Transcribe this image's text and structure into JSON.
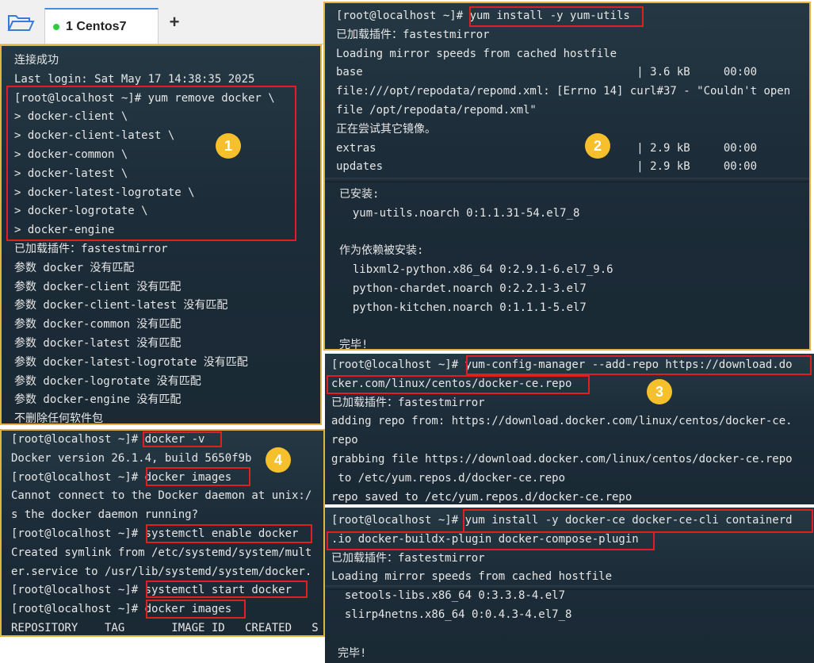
{
  "tabs": {
    "active_label": "1 Centos7",
    "add_label": "+"
  },
  "panel1": {
    "lines": [
      "连接成功",
      "Last login: Sat May 17 14:38:35 2025",
      "[root@localhost ~]# yum remove docker \\",
      "> docker-client \\",
      "> docker-client-latest \\",
      "> docker-common \\",
      "> docker-latest \\",
      "> docker-latest-logrotate \\",
      "> docker-logrotate \\",
      "> docker-engine",
      "已加载插件：fastestmirror",
      "参数 docker 没有匹配",
      "参数 docker-client 没有匹配",
      "参数 docker-client-latest 没有匹配",
      "参数 docker-common 没有匹配",
      "参数 docker-latest 没有匹配",
      "参数 docker-latest-logrotate 没有匹配",
      "参数 docker-logrotate 没有匹配",
      "参数 docker-engine 没有匹配",
      "不删除任何软件包"
    ],
    "badge": "1"
  },
  "panel2": {
    "lines": [
      "[root@localhost ~]# yum install -y yum-utils",
      "已加载插件：fastestmirror",
      "Loading mirror speeds from cached hostfile",
      "base                                         | 3.6 kB     00:00",
      "file:///opt/repodata/repomd.xml: [Errno 14] curl#37 - \"Couldn't open",
      "file /opt/repodata/repomd.xml\"",
      "正在尝试其它镜像。",
      "extras                                       | 2.9 kB     00:00",
      "updates                                      | 2.9 kB     00:00"
    ],
    "lines_b": [
      "已安装:",
      "  yum-utils.noarch 0:1.1.31-54.el7_8",
      "",
      "作为依赖被安装:",
      "  libxml2-python.x86_64 0:2.9.1-6.el7_9.6",
      "  python-chardet.noarch 0:2.2.1-3.el7",
      "  python-kitchen.noarch 0:1.1.1-5.el7",
      "",
      "完毕!"
    ],
    "badge": "2"
  },
  "panel3": {
    "lines": [
      "[root@localhost ~]# yum-config-manager --add-repo https://download.do",
      "cker.com/linux/centos/docker-ce.repo",
      "已加载插件：fastestmirror",
      "adding repo from: https://download.docker.com/linux/centos/docker-ce.",
      "repo",
      "grabbing file https://download.docker.com/linux/centos/docker-ce.repo",
      " to /etc/yum.repos.d/docker-ce.repo",
      "repo saved to /etc/yum.repos.d/docker-ce.repo"
    ],
    "badge": "3"
  },
  "panel4": {
    "lines": [
      "[root@localhost ~]# docker -v",
      "Docker version 26.1.4, build 5650f9b",
      "[root@localhost ~]# docker images",
      "Cannot connect to the Docker daemon at unix:/",
      "s the docker daemon running?",
      "[root@localhost ~]# systemctl enable docker",
      "Created symlink from /etc/systemd/system/mult",
      "er.service to /usr/lib/systemd/system/docker.",
      "[root@localhost ~]# systemctl start docker",
      "[root@localhost ~]# docker images",
      "REPOSITORY    TAG       IMAGE ID   CREATED   S"
    ],
    "badge": "4"
  },
  "panel5": {
    "lines": [
      "[root@localhost ~]# yum install -y docker-ce docker-ce-cli containerd",
      ".io docker-buildx-plugin docker-compose-plugin",
      "已加载插件：fastestmirror",
      "Loading mirror speeds from cached hostfile",
      "  setools-libs.x86_64 0:3.3.8-4.el7",
      "  slirp4netns.x86_64 0:0.4.3-4.el7_8"
    ],
    "lines_b": [
      "完毕!"
    ]
  },
  "colors": {
    "terminal_bg": "#1f303c",
    "frame": "#e3b341",
    "highlight": "#e02020",
    "badge": "#f5c02c"
  }
}
